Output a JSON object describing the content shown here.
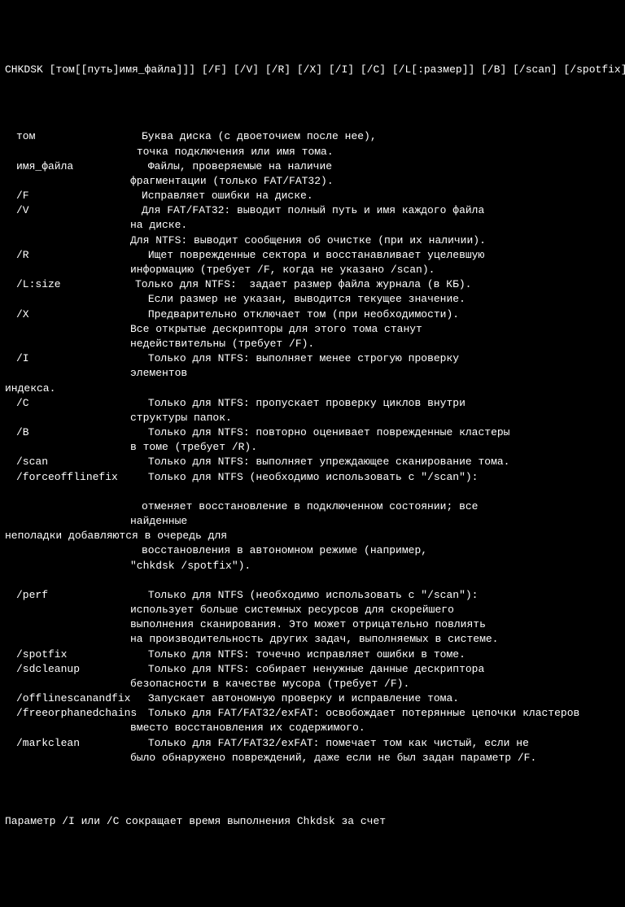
{
  "syntax": "CHKDSK [том[[путь]имя_файла]]] [/F] [/V] [/R] [/X] [/I] [/C] [/L[:размер]] [/B] [/scan] [/spotfix]",
  "params": [
    {
      "name": "том",
      "lines": [
        "Буква диска (с двоеточием после нее),",
        " точка подключения или имя тома."
      ]
    },
    {
      "name": "имя_файла",
      "lines": [
        " Файлы, проверяемые на наличие",
        "фрагментации (только FAT/FAT32)."
      ]
    },
    {
      "name": "/F",
      "lines": [
        "Исправляет ошибки на диске."
      ]
    },
    {
      "name": "/V",
      "lines": [
        "Для FAT/FAT32: выводит полный путь и имя каждого файла",
        "на диске.",
        "Для NTFS: выводит сообщения об очистке (при их наличии)."
      ]
    },
    {
      "name": "/R",
      "lines": [
        " Ищет поврежденные сектора и восстанавливает уцелевшую",
        "информацию (требует /F, когда не указано /scan)."
      ]
    },
    {
      "name": "/L:size",
      "lines": [
        "Только для NTFS:  задает размер файла журнала (в КБ)."
      ],
      "namePadOverride": 146
    },
    {
      "name": "",
      "lines": [
        " Если размер не указан, выводится текущее значение."
      ]
    },
    {
      "name": "/X",
      "lines": [
        " Предварительно отключает том (при необходимости).",
        "Все открытые дескрипторы для этого тома станут",
        "недействительны (требует /F)."
      ]
    },
    {
      "name": "/I",
      "lines": [
        " Только для NTFS: выполняет менее строгую проверку",
        "элементов"
      ],
      "flushLast": true,
      "flushText": "индекса."
    },
    {
      "name": "/C",
      "lines": [
        " Только для NTFS: пропускает проверку циклов внутри",
        "структуры папок."
      ]
    },
    {
      "name": "/B",
      "lines": [
        " Только для NTFS: повторно оценивает поврежденные кластеры",
        "в томе (требует /R)."
      ]
    },
    {
      "name": "/scan",
      "lines": [
        " Только для NTFS: выполняет упреждающее сканирование тома."
      ]
    },
    {
      "name": "/forceofflinefix",
      "lines": [
        " Только для NTFS (необходимо использовать с \"/scan\"):"
      ]
    },
    {
      "blank": true
    },
    {
      "name": "",
      "lines": [
        "отменяет восстановление в подключенном состоянии; все",
        "найденные"
      ],
      "flushLast": true,
      "flushText": "неполадки добавляются в очередь для"
    },
    {
      "name": "",
      "lines": [
        "восстановления в автономном режиме (например,",
        "\"chkdsk /spotfix\")."
      ]
    },
    {
      "blank": true
    },
    {
      "name": "/perf",
      "lines": [
        " Только для NTFS (необходимо использовать с \"/scan\"):",
        "использует больше системных ресурсов для скорейшего",
        "выполнения сканирования. Это может отрицательно повлиять",
        "на производительность других задач, выполняемых в системе."
      ]
    },
    {
      "name": "/spotfix",
      "lines": [
        " Только для NTFS: точечно исправляет ошибки в томе."
      ]
    },
    {
      "name": "/sdcleanup",
      "lines": [
        " Только для NTFS: собирает ненужные данные дескриптора",
        "безопасности в качестве мусора (требует /F)."
      ]
    },
    {
      "name": "/offlinescanandfix",
      "lines": [
        " Запускает автономную проверку и исправление тома."
      ]
    },
    {
      "name": "/freeorphanedchains",
      "lines": [
        " Только для FAT/FAT32/exFAT: освобождает потерянные цепочки кластеров",
        "вместо восстановления их содержимого."
      ]
    },
    {
      "name": "/markclean",
      "lines": [
        " Только для FAT/FAT32/exFAT: помечает том как чистый, если не",
        "было обнаружено повреждений, даже если не был задан параметр /F."
      ]
    }
  ],
  "footer": "Параметр /I или /C сокращает время выполнения Chkdsk за счет"
}
